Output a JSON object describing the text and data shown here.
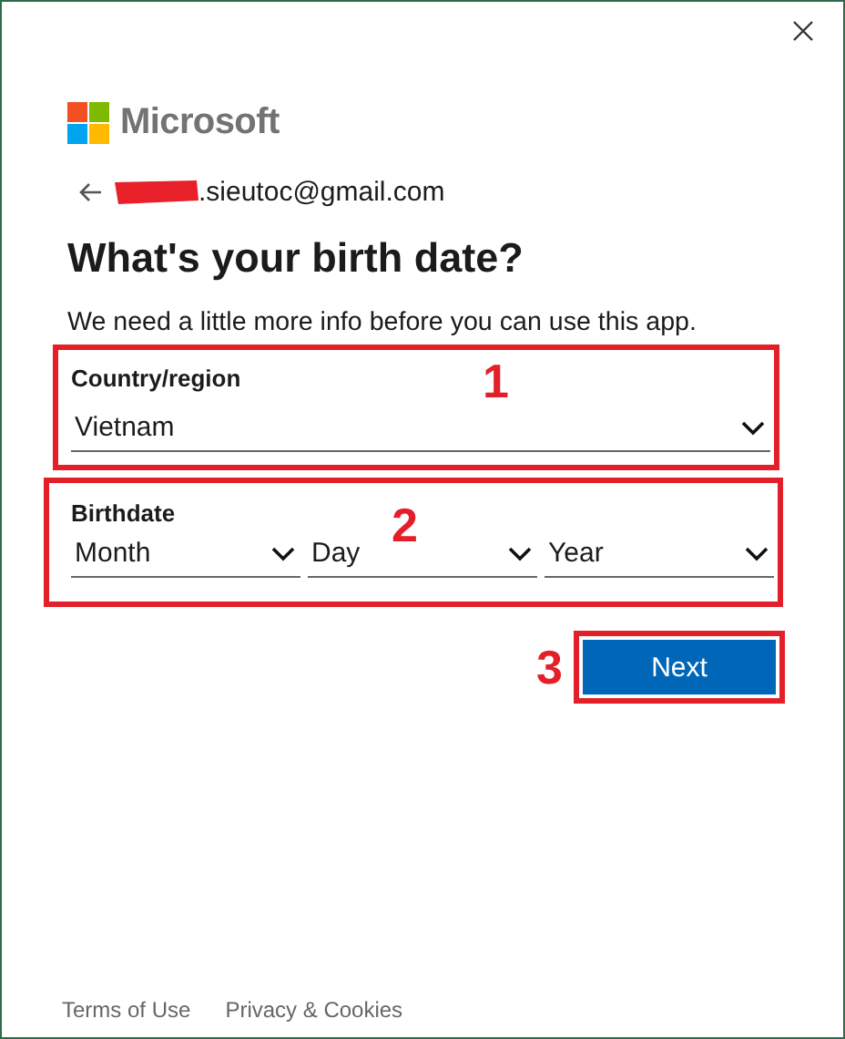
{
  "brand": {
    "name": "Microsoft"
  },
  "account": {
    "email": ".sieutoc@gmail.com",
    "redacted": true
  },
  "title": "What's your birth date?",
  "subtitle": "We need a little more info before you can use this app.",
  "country": {
    "label": "Country/region",
    "value": "Vietnam",
    "annotation": "1"
  },
  "birthdate": {
    "label": "Birthdate",
    "annotation": "2",
    "fields": [
      {
        "text": "Month"
      },
      {
        "text": "Day"
      },
      {
        "text": "Year"
      }
    ]
  },
  "next_button": {
    "label": "Next",
    "annotation": "3"
  },
  "footer_links": [
    "Terms of Use",
    "Privacy & Cookies"
  ]
}
